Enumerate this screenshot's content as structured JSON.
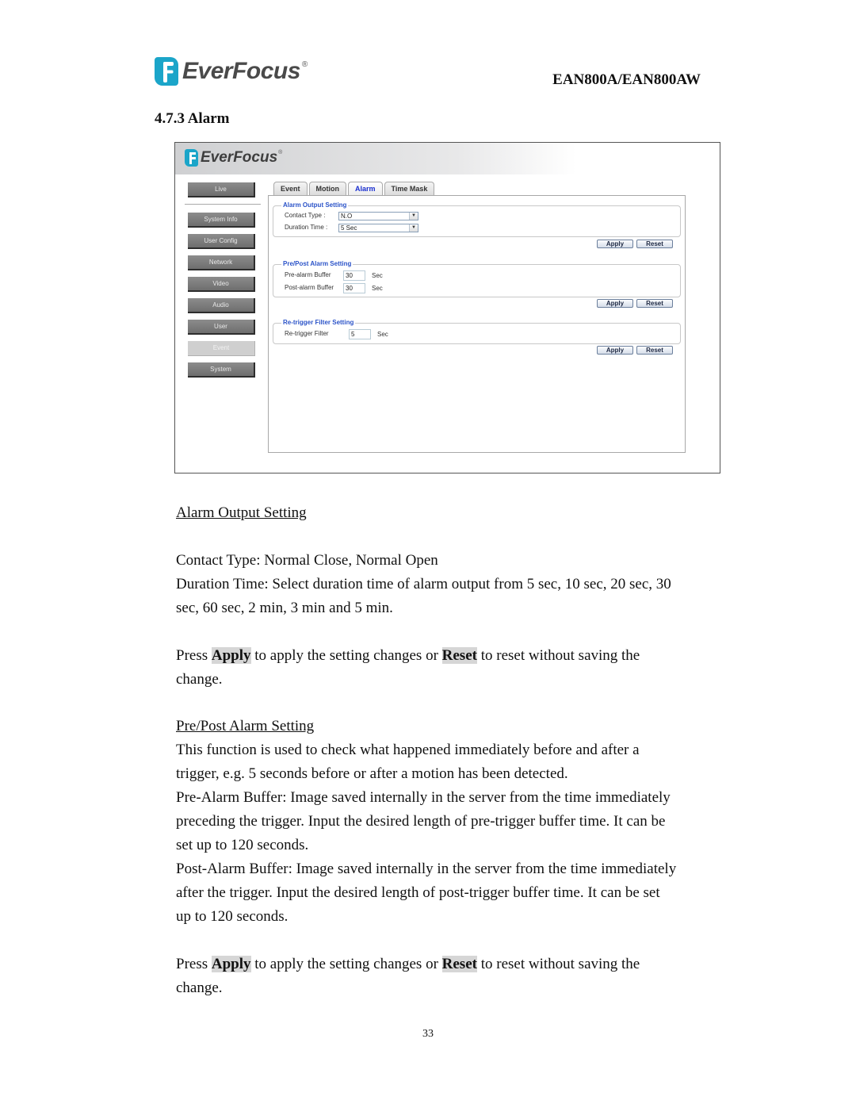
{
  "header": {
    "logo_text": "EverFocus",
    "logo_mark": "®",
    "model": "EAN800A/EAN800AW"
  },
  "section_title": "4.7.3 Alarm",
  "screenshot": {
    "banner_logo": "EverFocus",
    "banner_mark": "®",
    "nav": {
      "live": "Live",
      "items": [
        {
          "label": "System Info"
        },
        {
          "label": "User Config"
        },
        {
          "label": "Network"
        },
        {
          "label": "Video"
        },
        {
          "label": "Audio"
        },
        {
          "label": "User"
        },
        {
          "label": "Event",
          "active": true
        },
        {
          "label": "System"
        }
      ]
    },
    "tabs": [
      {
        "label": "Event"
      },
      {
        "label": "Motion"
      },
      {
        "label": "Alarm",
        "active": true
      },
      {
        "label": "Time Mask"
      }
    ],
    "alarm_output": {
      "legend": "Alarm Output Setting",
      "contact_type_label": "Contact Type :",
      "contact_type_value": "N.O",
      "duration_label": "Duration Time :",
      "duration_value": "5 Sec",
      "apply": "Apply",
      "reset": "Reset"
    },
    "pre_post": {
      "legend": "Pre/Post Alarm Setting",
      "pre_label": "Pre-alarm Buffer",
      "pre_value": "30",
      "post_label": "Post-alarm Buffer",
      "post_value": "30",
      "unit": "Sec",
      "apply": "Apply",
      "reset": "Reset"
    },
    "retrigger": {
      "legend": "Re-trigger Filter Setting",
      "label": "Re-trigger Filter",
      "value": "5",
      "unit": "Sec",
      "apply": "Apply",
      "reset": "Reset"
    },
    "dropdown_arrow": "▼"
  },
  "body": {
    "h_alarm_output": "Alarm Output Setting",
    "contact_type": "Contact Type: Normal Close, Normal Open",
    "duration_1": "Duration Time: Select duration time of alarm output from 5 sec, 10 sec, 20 sec, 30",
    "duration_2": "sec, 60 sec, 2 min, 3 min and 5 min.",
    "press_a": "Press ",
    "apply": "Apply",
    "press_b": " to apply the setting changes or ",
    "reset": "Reset",
    "press_c": " to reset without saving the",
    "change": "change.",
    "h_pre_post": "Pre/Post Alarm Setting",
    "func_1": "This function is used to check what happened immediately before and after a",
    "func_2": "trigger, e.g. 5 seconds before or after a motion has been detected.",
    "pre_1": "Pre-Alarm Buffer: Image saved internally in the server from the time immediately",
    "pre_2": "preceding the trigger. Input the desired length of pre-trigger buffer time. It can be",
    "pre_3": "set up to 120 seconds.",
    "post_1": "Post-Alarm Buffer: Image saved internally in the server from the time immediately",
    "post_2": "after the trigger. Input the desired length of post-trigger buffer time. It can be set",
    "post_3": "up to 120 seconds."
  },
  "page_number": "33"
}
